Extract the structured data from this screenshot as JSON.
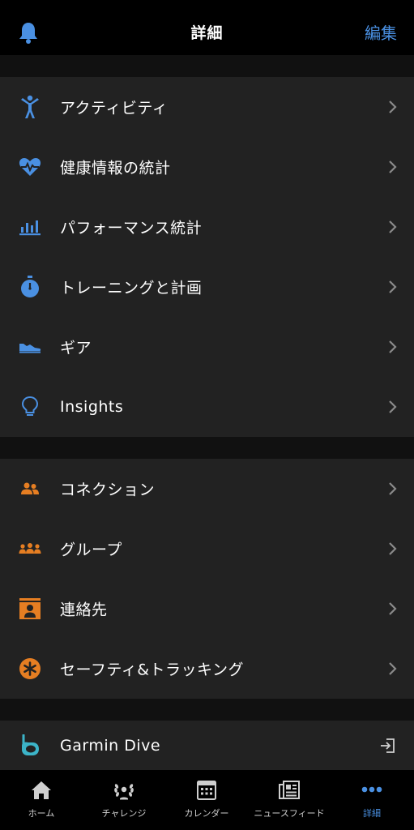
{
  "header": {
    "title": "詳細",
    "edit_label": "編集"
  },
  "colors": {
    "accent_blue": "#4a90e2",
    "accent_orange": "#e67e22",
    "teal": "#3cb4c8"
  },
  "sections": [
    {
      "items": [
        {
          "label": "アクティビティ",
          "icon": "activity-person-icon"
        },
        {
          "label": "健康情報の統計",
          "icon": "heart-pulse-icon"
        },
        {
          "label": "パフォーマンス統計",
          "icon": "bar-chart-icon"
        },
        {
          "label": "トレーニングと計画",
          "icon": "stopwatch-icon"
        },
        {
          "label": "ギア",
          "icon": "shoe-icon"
        },
        {
          "label": "Insights",
          "icon": "lightbulb-icon"
        }
      ]
    },
    {
      "items": [
        {
          "label": "コネクション",
          "icon": "connections-icon"
        },
        {
          "label": "グループ",
          "icon": "groups-icon"
        },
        {
          "label": "連絡先",
          "icon": "contact-card-icon"
        },
        {
          "label": "セーフティ&トラッキング",
          "icon": "safety-asterisk-icon"
        }
      ]
    },
    {
      "items": [
        {
          "label": "Garmin Dive",
          "icon": "snorkel-icon"
        }
      ]
    }
  ],
  "tabbar": {
    "tabs": [
      {
        "label": "ホーム",
        "icon": "home-icon"
      },
      {
        "label": "チャレンジ",
        "icon": "laurel-icon"
      },
      {
        "label": "カレンダー",
        "icon": "calendar-icon"
      },
      {
        "label": "ニュースフィード",
        "icon": "newsfeed-icon"
      },
      {
        "label": "詳細",
        "icon": "more-dots-icon",
        "active": true
      }
    ]
  }
}
